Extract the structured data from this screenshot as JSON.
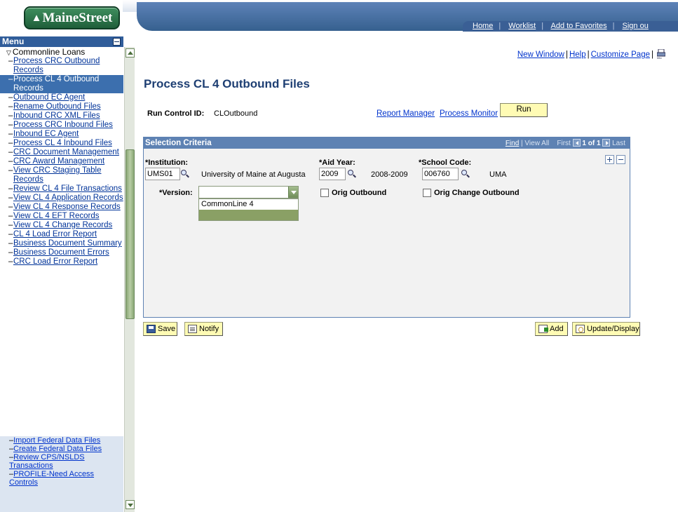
{
  "brand": {
    "logo_text": "MaineStreet"
  },
  "header_links": [
    "Home",
    "Worklist",
    "Add to Favorites",
    "Sign ou"
  ],
  "menu": {
    "title": "Menu",
    "section": "Commonline Loans",
    "items": [
      "Process CRC Outbound Records",
      "Process CL 4 Outbound Records",
      "Outbound EC Agent",
      "Rename Outbound Files",
      "Inbound CRC XML Files",
      "Process CRC Inbound Files",
      "Inbound EC Agent",
      "Process CL 4 Inbound Files",
      "CRC Document Management",
      "CRC Award Management",
      "View CRC Staging Table Records",
      "Review CL 4 File Transactions",
      "View CL 4 Application Records",
      "View CL 4 Response Records",
      "View CL 4 EFT Records",
      "View CL 4 Change Records",
      "CL 4 Load Error Report",
      "Business Document Summary",
      "Business Document Errors",
      "CRC Load Error Report"
    ],
    "active_index": 1,
    "lower_items": [
      "Import Federal Data Files",
      "Create Federal Data Files",
      "Review CPS/NSLDS Transactions",
      "PROFILE-Need Access Controls"
    ]
  },
  "page_links": {
    "new_window": "New Window",
    "help": "Help",
    "customize": "Customize Page",
    "print_label": "http"
  },
  "page_title": "Process CL 4 Outbound Files",
  "run_control": {
    "label": "Run Control ID:",
    "value": "CLOutbound"
  },
  "process_links": {
    "report_manager": "Report Manager",
    "process_monitor": "Process Monitor"
  },
  "run_button": "Run",
  "criteria": {
    "header": "Selection Criteria",
    "nav": {
      "find": "Find",
      "view_all": "View All",
      "first": "First",
      "count": "1 of 1",
      "last": "Last"
    },
    "institution": {
      "label": "*Institution:",
      "value": "UMS01",
      "description": "University of Maine at Augusta"
    },
    "aid_year": {
      "label": "*Aid Year:",
      "value": "2009",
      "description": "2008-2009"
    },
    "school_code": {
      "label": "*School Code:",
      "value": "006760",
      "description": "UMA"
    },
    "version": {
      "label": "*Version:",
      "value": "",
      "options": [
        "CommonLine 4",
        ""
      ]
    },
    "orig_outbound": {
      "label": "Orig Outbound",
      "checked": false
    },
    "orig_change_outbound": {
      "label": "Orig Change Outbound",
      "checked": false
    }
  },
  "toolbar": {
    "save": "Save",
    "notify": "Notify",
    "add": "Add",
    "update_display": "Update/Display"
  }
}
